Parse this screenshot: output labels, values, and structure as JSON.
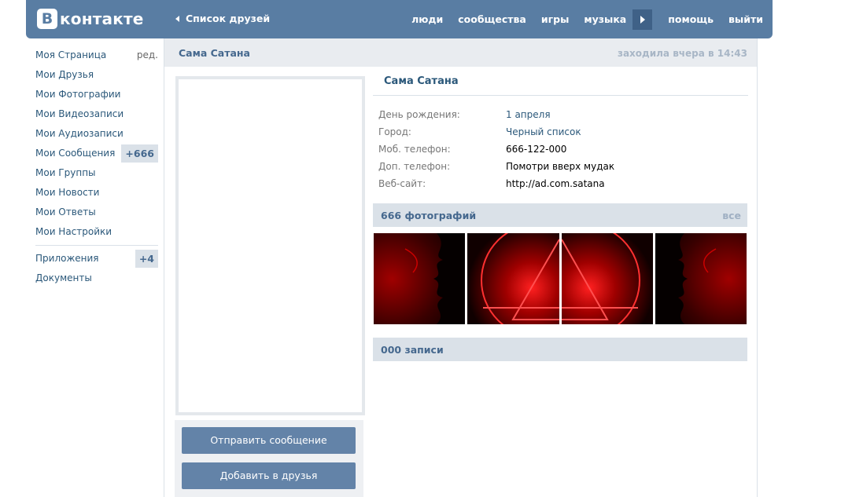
{
  "header": {
    "logo_letter": "В",
    "logo_text": "контакте",
    "back_label": "Список друзей",
    "nav": {
      "people": "люди",
      "communities": "сообщества",
      "games": "игры",
      "music": "музыка",
      "help": "помощь",
      "logout": "выйти"
    },
    "brand_color": "#597da3"
  },
  "sidebar": {
    "items": [
      {
        "label": "Моя Страница",
        "extra": "ред."
      },
      {
        "label": "Мои Друзья"
      },
      {
        "label": "Мои Фотографии"
      },
      {
        "label": "Мои Видеозаписи"
      },
      {
        "label": "Мои Аудиозаписи"
      },
      {
        "label": "Мои Сообщения",
        "badge": "+666"
      },
      {
        "label": "Мои Группы"
      },
      {
        "label": "Мои Новости"
      },
      {
        "label": "Мои Ответы"
      },
      {
        "label": "Мои Настройки"
      }
    ],
    "secondary": [
      {
        "label": "Приложения",
        "badge": "+4"
      },
      {
        "label": "Документы"
      }
    ]
  },
  "profile": {
    "header_name": "Сама Сатана",
    "last_seen": "заходила вчера в 14:43",
    "name": "Сама Сатана",
    "info": [
      {
        "label": "День рождения:",
        "value": "1 апреля"
      },
      {
        "label": "Город:",
        "value": "Черный список"
      },
      {
        "label": "Моб. телефон:",
        "value": "666-122-000"
      },
      {
        "label": "Доп. телефон:",
        "value": "Помотри вверх мудак"
      },
      {
        "label": "Веб-сайт:",
        "value": "http://ad.com.satana"
      }
    ],
    "photos_title": "666 фотографий",
    "photos_all": "все",
    "posts_title": "000 записи",
    "send_message": "Отправить сообщение",
    "add_friend": "Добавить в друзья"
  }
}
